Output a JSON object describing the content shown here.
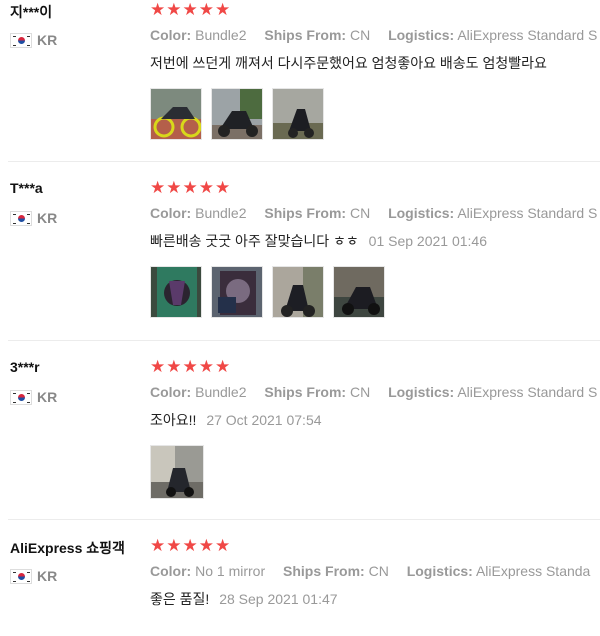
{
  "reviews": [
    {
      "user": "지***이",
      "country": "KR",
      "stars": "★★★★★",
      "color_label": "Color:",
      "color_value": "Bundle2",
      "ships_label": "Ships From:",
      "ships_value": "CN",
      "logistics_label": "Logistics:",
      "logistics_value": "AliExpress Standard S",
      "text": "저번에 쓰던게 깨져서 다시주문했어요 엄청좋아요 배송도 엄청빨라요",
      "date": "",
      "photos": [
        "motorcycle-photo",
        "motorcycle-photo",
        "motorcycle-photo"
      ]
    },
    {
      "user": "T***a",
      "country": "KR",
      "stars": "★★★★★",
      "color_label": "Color:",
      "color_value": "Bundle2",
      "ships_label": "Ships From:",
      "ships_value": "CN",
      "logistics_label": "Logistics:",
      "logistics_value": "AliExpress Standard S",
      "text": "빠른배송 굿굿 아주 잘맞습니다 ㅎㅎ",
      "date": "01 Sep 2021 01:46",
      "photos": [
        "mirror-photo",
        "mirror-photo",
        "motorcycle-photo",
        "motorcycle-photo"
      ]
    },
    {
      "user": "3***r",
      "country": "KR",
      "stars": "★★★★★",
      "color_label": "Color:",
      "color_value": "Bundle2",
      "ships_label": "Ships From:",
      "ships_value": "CN",
      "logistics_label": "Logistics:",
      "logistics_value": "AliExpress Standard S",
      "text": "조아요!!",
      "date": "27 Oct 2021 07:54",
      "photos": [
        "scooter-photo"
      ]
    },
    {
      "user": "AliExpress 쇼핑객",
      "country": "KR",
      "stars": "★★★★★",
      "color_label": "Color:",
      "color_value": "No 1 mirror",
      "ships_label": "Ships From:",
      "ships_value": "CN",
      "logistics_label": "Logistics:",
      "logistics_value": "AliExpress Standa",
      "text": "좋은 품질!",
      "date": "28 Sep 2021 01:47",
      "photos": []
    }
  ]
}
